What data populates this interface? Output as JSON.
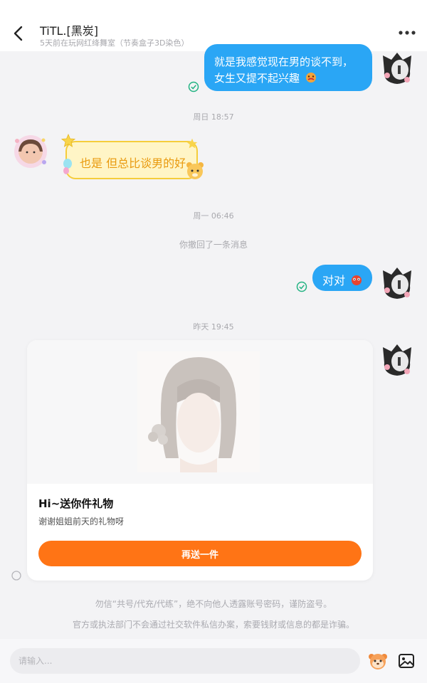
{
  "header": {
    "title": "TiTL.[黑炭]",
    "subtitle": "5天前在玩网红绛舞室（节奏盒子3D染色）"
  },
  "messages": {
    "msg1_line1": "就是我感觉现在男的谈不到，",
    "msg1_line2": "女生又提不起兴趣",
    "ts1": "周日 18:57",
    "msg2": "也是 但总比谈男的好",
    "ts2": "周一 06:46",
    "recall": "你撤回了一条消息",
    "msg3": "对对",
    "ts3": "昨天 19:45"
  },
  "gift_card": {
    "title": "Hi~送你件礼物",
    "subtitle": "谢谢姐姐前天的礼物呀",
    "button": "再送一件"
  },
  "notices": {
    "line1": "勿信“共号/代充/代练”，绝不向他人透露账号密码，谨防盗号。",
    "line2": "官方或执法部门不会通过社交软件私信办案，索要钱财或信息的都是诈骗。"
  },
  "composer": {
    "placeholder": "请输入..."
  },
  "colors": {
    "bubble_blue": "#2aa6f5",
    "bubble_yellow": "#fff5c6",
    "accent_orange": "#ff7415",
    "read_check": "#22b382"
  }
}
